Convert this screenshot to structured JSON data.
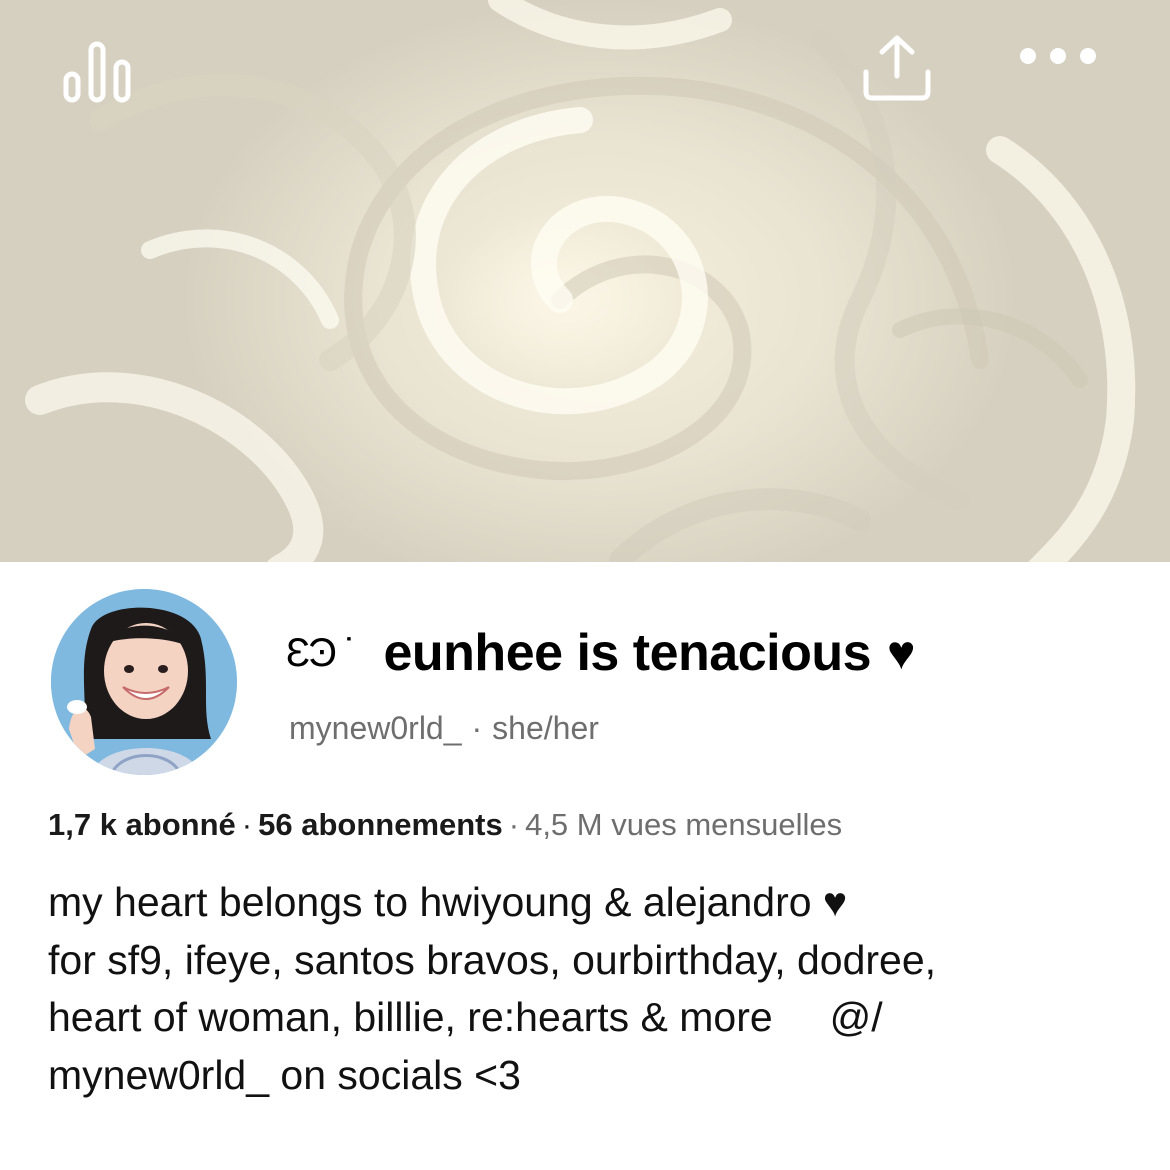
{
  "cover": {
    "stats_icon": "bar-chart-icon",
    "share_icon": "share-upload-icon",
    "more_icon": "more-horizontal-icon"
  },
  "profile": {
    "name_deco": "ƐϿ ˙",
    "name": "eunhee is tenacious",
    "name_heart": "♥",
    "handle": "mynew0rld_",
    "separator": "·",
    "pronouns": "she/her",
    "avatar": "profile-avatar"
  },
  "stats": {
    "followers": "1,7 k abonné",
    "dot1": "·",
    "following": "56 abonnements",
    "dot2": "·",
    "monthly_views": "4,5 M vues mensuelles"
  },
  "bio": {
    "line1": "my heart belongs to hwiyoung & alejandro ♥",
    "line2": "for sf9, ifeye, santos bravos, ourbirthday, dodree,",
    "line3": "heart of woman, billlie, re:hearts & more     @/",
    "line4": "mynew0rld_ on socials <3"
  },
  "colors": {
    "muted_text": "#6e6e6e",
    "cover_cream": "#f2ecd9"
  }
}
